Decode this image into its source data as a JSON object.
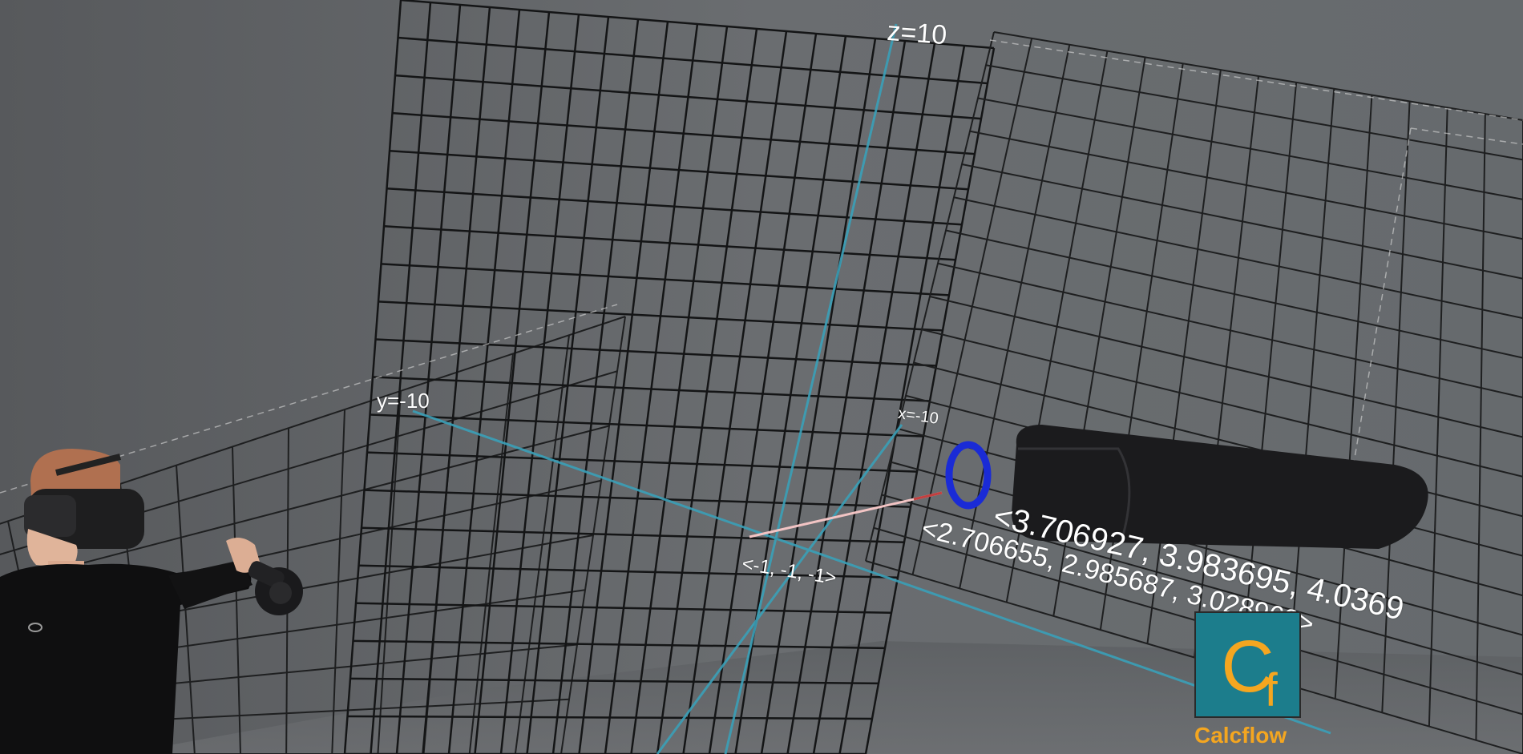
{
  "scene": {
    "axis_labels": {
      "z": "z=10",
      "y": "y=-10",
      "x": "x=-10"
    },
    "vector_origin_label": "<-1, -1, -1>",
    "vector_readouts": {
      "first": "<3.706927, 3.983695, 4.0369",
      "second": "<2.706655, 2.985687, 3.028968>"
    },
    "colors": {
      "background": "#5c5f62",
      "grid_line": "#1a1a1a",
      "axis_line": "#3aa0b8",
      "ring": "#1a2bd6",
      "vector": "#f2b8b8",
      "controller": "#1b1b1d"
    }
  },
  "logo": {
    "mark_big": "C",
    "mark_small": "f",
    "caption": "Calcflow",
    "colors": {
      "box": "#1c7d8c",
      "text": "#f4a620"
    }
  },
  "person": {
    "icon": "person-with-vr-headset-icon"
  }
}
